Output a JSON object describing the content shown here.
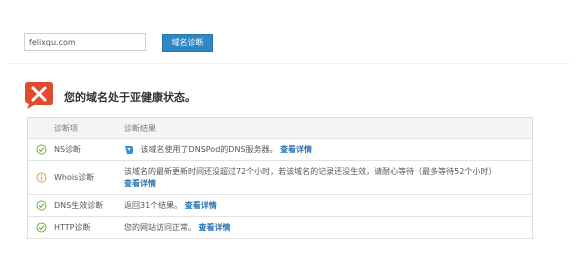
{
  "search": {
    "value": "felixqu.com",
    "button_label": "域名诊断"
  },
  "status": {
    "title": "您的域名处于亚健康状态。",
    "icon": "error-x-icon",
    "color": "#e04a2f"
  },
  "table": {
    "headers": [
      "诊断项",
      "诊断结果"
    ],
    "rows": [
      {
        "status_icon": "check-icon",
        "name": "NS诊断",
        "result": "该域名使用了DNSPod的DNS服务器。",
        "link": "查看详情"
      },
      {
        "status_icon": "info-icon",
        "name": "Whois诊断",
        "result": "该域名的最新更新时间还没超过72个小时，若该域名的记录还没生效，请耐心等待（最多等待52个小时）",
        "link": "查看详情"
      },
      {
        "status_icon": "check-icon",
        "name": "DNS生效诊断",
        "result": "返回31个结果。",
        "link": "查看详情"
      },
      {
        "status_icon": "check-icon",
        "name": "HTTP诊断",
        "result": "您的网站访问正常。",
        "link": "查看详情"
      }
    ]
  },
  "colors": {
    "accent": "#2f87c4",
    "ok": "#6aae3a",
    "warn": "#d9a23a",
    "link": "#2a74b3"
  }
}
